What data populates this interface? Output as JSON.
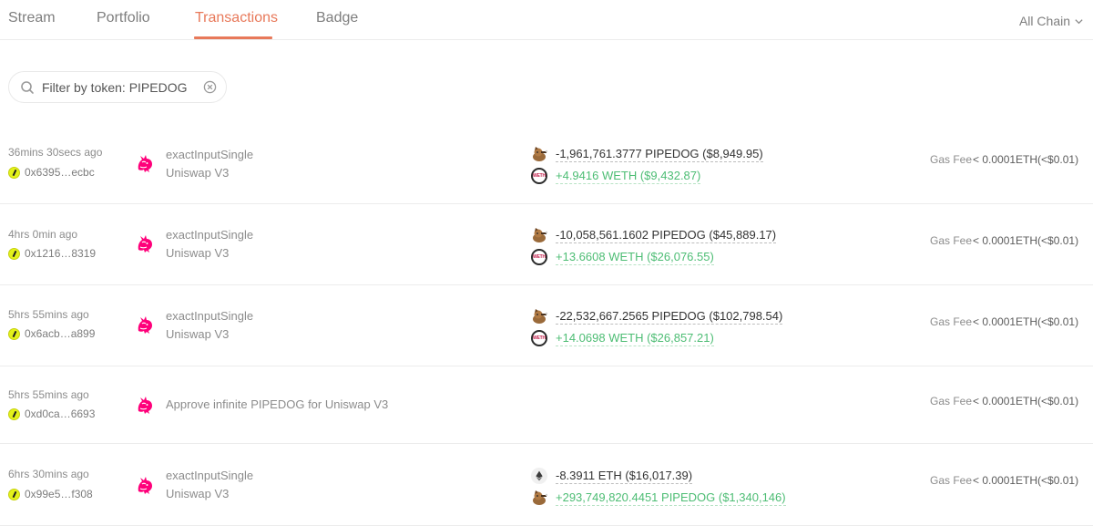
{
  "tabs": [
    {
      "label": "Stream"
    },
    {
      "label": "Portfolio"
    },
    {
      "label": "Transactions"
    },
    {
      "label": "Badge"
    }
  ],
  "chain_selector": {
    "label": "All Chain"
  },
  "filter": {
    "text": "Filter by token: PIPEDOG"
  },
  "gas_label": "Gas Fee",
  "rows": [
    {
      "time": "36mins 30secs ago",
      "hash": "0x6395…ecbc",
      "method": "exactInputSingle",
      "protocol": "Uniswap V3",
      "out": "-1,961,761.3777 PIPEDOG ($8,949.95)",
      "in": "+4.9416 WETH ($9,432.87)",
      "gas": "< 0.0001ETH(<$0.01)"
    },
    {
      "time": "4hrs 0min ago",
      "hash": "0x1216…8319",
      "method": "exactInputSingle",
      "protocol": "Uniswap V3",
      "out": "-10,058,561.1602 PIPEDOG ($45,889.17)",
      "in": "+13.6608 WETH ($26,076.55)",
      "gas": "< 0.0001ETH(<$0.01)"
    },
    {
      "time": "5hrs 55mins ago",
      "hash": "0x6acb…a899",
      "method": "exactInputSingle",
      "protocol": "Uniswap V3",
      "out": "-22,532,667.2565 PIPEDOG ($102,798.54)",
      "in": "+14.0698 WETH ($26,857.21)",
      "gas": "< 0.0001ETH(<$0.01)"
    },
    {
      "time": "5hrs 55mins ago",
      "hash": "0xd0ca…6693",
      "approve": "Approve infinite PIPEDOG for Uniswap V3",
      "gas": "< 0.0001ETH(<$0.01)"
    },
    {
      "time": "6hrs 30mins ago",
      "hash": "0x99e5…f308",
      "method": "exactInputSingle",
      "protocol": "Uniswap V3",
      "out": "-8.3911 ETH ($16,017.39)",
      "in": "+293,749,820.4451 PIPEDOG ($1,340,146)",
      "gas": "< 0.0001ETH(<$0.01)"
    }
  ],
  "icons": {
    "protocol": "uniswap-unicorn-icon",
    "pipedog": "pipedog-token-icon",
    "weth": "weth-token-icon",
    "weth_text": "WETH",
    "eth": "eth-token-icon"
  },
  "colors": {
    "accent": "#e8795a",
    "positive": "#4dbd74",
    "uniswap": "#ff007a"
  }
}
